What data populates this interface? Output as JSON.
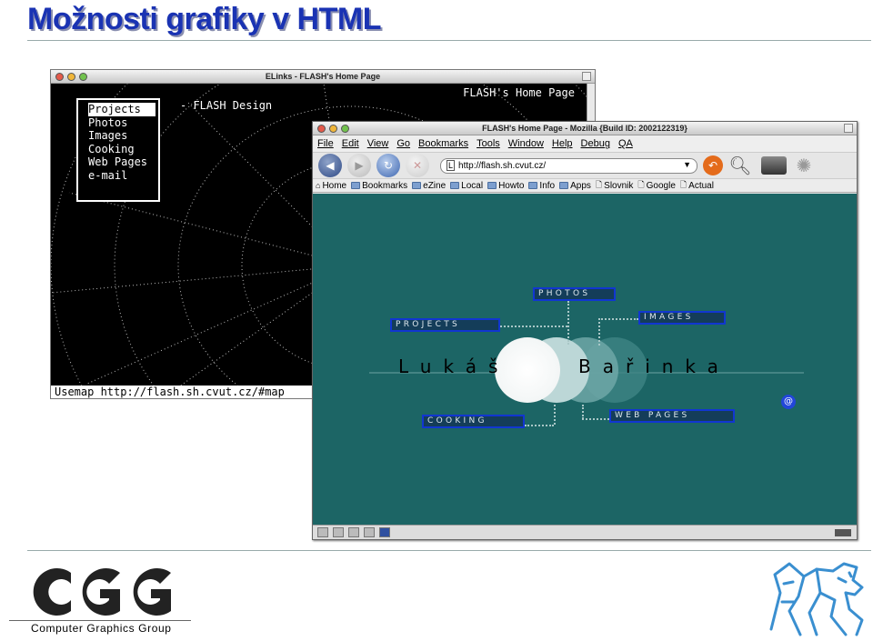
{
  "slide": {
    "title": "Možnosti grafiky v HTML"
  },
  "elinks": {
    "window_title": "ELinks - FLASH's Home Page",
    "page_heading": "FLASH's Home Page",
    "design_text": "- FLASH Design",
    "menu_items": [
      "Projects",
      "Photos",
      "Images",
      "Cooking",
      "Web Pages",
      "e-mail"
    ],
    "status": "Usemap http://flash.sh.cvut.cz/#map"
  },
  "mozilla": {
    "window_title": "FLASH's Home Page - Mozilla {Build ID: 2002122319}",
    "menu": [
      "File",
      "Edit",
      "View",
      "Go",
      "Bookmarks",
      "Tools",
      "Window",
      "Help",
      "Debug",
      "QA"
    ],
    "url": "http://flash.sh.cvut.cz/",
    "bookmarks": [
      "Home",
      "Bookmarks",
      "eZine",
      "Local",
      "Howto",
      "Info",
      "Apps",
      "Slovnik",
      "Google",
      "Actual"
    ],
    "page": {
      "background": "#1c6565",
      "nav": {
        "photos": "Photos",
        "projects": "Projects",
        "images": "Images",
        "cooking": "Cooking",
        "web_pages": "Web Pages"
      },
      "first_name": "Lukáš",
      "last_name": "Bařinka",
      "email_symbol": "@"
    }
  },
  "footer": {
    "logo_text": "CGG",
    "group_name": "Computer Graphics Group"
  },
  "colors": {
    "title_blue": "#1a33b3",
    "button_border": "#1136d1",
    "terminal_bg": "#000000"
  }
}
